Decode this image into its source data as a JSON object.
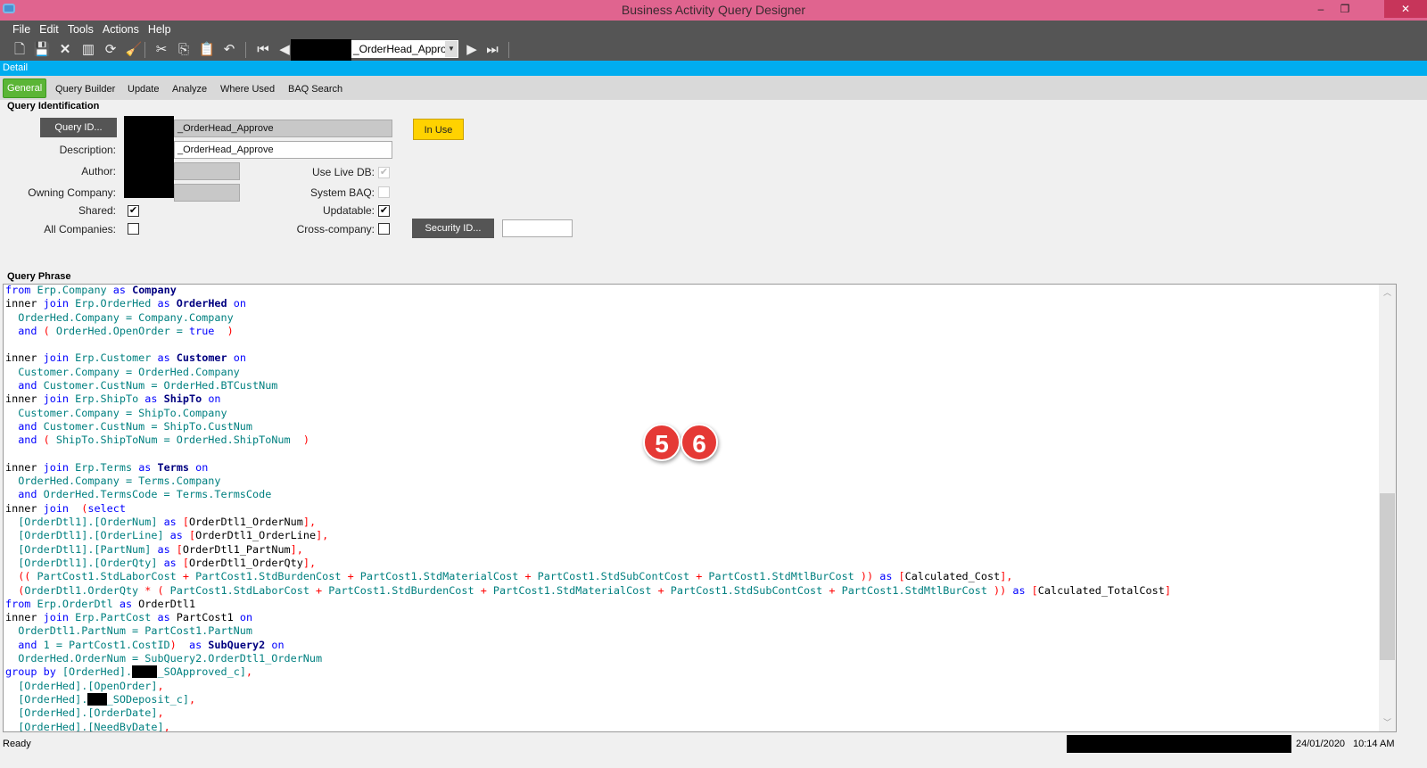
{
  "window": {
    "title": "Business Activity Query Designer",
    "min": "–",
    "restore": "❐",
    "close": "✕"
  },
  "menu": [
    "File",
    "Edit",
    "Tools",
    "Actions",
    "Help"
  ],
  "toolbar": {
    "record_combo": "_OrderHead_Appro"
  },
  "detail_bar": "Detail",
  "tabs": [
    "General",
    "Query Builder",
    "Update",
    "Analyze",
    "Where Used",
    "BAQ Search"
  ],
  "query_identification": {
    "section": "Query Identification",
    "query_id_button": "Query ID...",
    "query_id": "_OrderHead_Approve",
    "in_use_button": "In Use",
    "description_label": "Description:",
    "description": "_OrderHead_Approve",
    "author_label": "Author:",
    "owning_company_label": "Owning Company:",
    "shared_label": "Shared:",
    "shared": true,
    "all_companies_label": "All Companies:",
    "all_companies": false,
    "use_live_db_label": "Use Live DB:",
    "use_live_db": true,
    "system_baq_label": "System BAQ:",
    "system_baq": false,
    "updatable_label": "Updatable:",
    "updatable": true,
    "cross_company_label": "Cross-company:",
    "cross_company": false,
    "security_id_button": "Security ID...",
    "security_id": ""
  },
  "query_phrase": {
    "section": "Query Phrase",
    "lines": [
      [
        [
          "k",
          "from"
        ],
        [
          "i",
          " Erp.Company "
        ],
        [
          "k",
          "as"
        ],
        [
          "a",
          " Company"
        ]
      ],
      [
        [
          "p",
          "inner "
        ],
        [
          "k",
          "join"
        ],
        [
          "i",
          " Erp.OrderHed "
        ],
        [
          "k",
          "as"
        ],
        [
          "a",
          " OrderHed"
        ],
        [
          "k",
          " on"
        ]
      ],
      [
        [
          "i",
          "  OrderHed.Company = Company.Company"
        ]
      ],
      [
        [
          "k",
          "  and"
        ],
        [
          "r",
          " ("
        ],
        [
          "i",
          " OrderHed.OpenOrder = "
        ],
        [
          "k",
          "true"
        ],
        [
          "r",
          "  )"
        ]
      ],
      [],
      [
        [
          "p",
          "inner "
        ],
        [
          "k",
          "join"
        ],
        [
          "i",
          " Erp.Customer "
        ],
        [
          "k",
          "as"
        ],
        [
          "a",
          " Customer"
        ],
        [
          "k",
          " on"
        ]
      ],
      [
        [
          "i",
          "  Customer.Company = OrderHed.Company"
        ]
      ],
      [
        [
          "k",
          "  and"
        ],
        [
          "i",
          " Customer.CustNum = OrderHed.BTCustNum"
        ]
      ],
      [
        [
          "p",
          "inner "
        ],
        [
          "k",
          "join"
        ],
        [
          "i",
          " Erp.ShipTo "
        ],
        [
          "k",
          "as"
        ],
        [
          "a",
          " ShipTo"
        ],
        [
          "k",
          " on"
        ]
      ],
      [
        [
          "i",
          "  Customer.Company = ShipTo.Company"
        ]
      ],
      [
        [
          "k",
          "  and"
        ],
        [
          "i",
          " Customer.CustNum = ShipTo.CustNum"
        ]
      ],
      [
        [
          "k",
          "  and"
        ],
        [
          "r",
          " ("
        ],
        [
          "i",
          " ShipTo.ShipToNum = OrderHed.ShipToNum  "
        ],
        [
          "r",
          ")"
        ]
      ],
      [],
      [
        [
          "p",
          "inner "
        ],
        [
          "k",
          "join"
        ],
        [
          "i",
          " Erp.Terms "
        ],
        [
          "k",
          "as"
        ],
        [
          "a",
          " Terms"
        ],
        [
          "k",
          " on"
        ]
      ],
      [
        [
          "i",
          "  OrderHed.Company = Terms.Company"
        ]
      ],
      [
        [
          "k",
          "  and"
        ],
        [
          "i",
          " OrderHed.TermsCode = Terms.TermsCode"
        ]
      ],
      [
        [
          "p",
          "inner "
        ],
        [
          "k",
          "join"
        ],
        [
          "r",
          "  ("
        ],
        [
          "k",
          "select"
        ]
      ],
      [
        [
          "i",
          "  [OrderDtl1].[OrderNum] "
        ],
        [
          "k",
          "as"
        ],
        [
          "r",
          " ["
        ],
        [
          "p",
          "OrderDtl1_OrderNum"
        ],
        [
          "r",
          "],"
        ]
      ],
      [
        [
          "i",
          "  [OrderDtl1].[OrderLine] "
        ],
        [
          "k",
          "as"
        ],
        [
          "r",
          " ["
        ],
        [
          "p",
          "OrderDtl1_OrderLine"
        ],
        [
          "r",
          "],"
        ]
      ],
      [
        [
          "i",
          "  [OrderDtl1].[PartNum] "
        ],
        [
          "k",
          "as"
        ],
        [
          "r",
          " ["
        ],
        [
          "p",
          "OrderDtl1_PartNum"
        ],
        [
          "r",
          "],"
        ]
      ],
      [
        [
          "i",
          "  [OrderDtl1].[OrderQty] "
        ],
        [
          "k",
          "as"
        ],
        [
          "r",
          " ["
        ],
        [
          "p",
          "OrderDtl1_OrderQty"
        ],
        [
          "r",
          "],"
        ]
      ],
      [
        [
          "r",
          "  (("
        ],
        [
          "i",
          " PartCost1.StdLaborCost "
        ],
        [
          "r",
          "+"
        ],
        [
          "i",
          " PartCost1.StdBurdenCost "
        ],
        [
          "r",
          "+"
        ],
        [
          "i",
          " PartCost1.StdMaterialCost "
        ],
        [
          "r",
          "+"
        ],
        [
          "i",
          " PartCost1.StdSubContCost "
        ],
        [
          "r",
          "+"
        ],
        [
          "i",
          " PartCost1.StdMtlBurCost "
        ],
        [
          "r",
          "))"
        ],
        [
          "k",
          " as"
        ],
        [
          "r",
          " ["
        ],
        [
          "p",
          "Calculated_Cost"
        ],
        [
          "r",
          "],"
        ]
      ],
      [
        [
          "r",
          "  ("
        ],
        [
          "i",
          "OrderDtl1.OrderQty "
        ],
        [
          "r",
          "* ("
        ],
        [
          "i",
          " PartCost1.StdLaborCost "
        ],
        [
          "r",
          "+"
        ],
        [
          "i",
          " PartCost1.StdBurdenCost "
        ],
        [
          "r",
          "+"
        ],
        [
          "i",
          " PartCost1.StdMaterialCost "
        ],
        [
          "r",
          "+"
        ],
        [
          "i",
          " PartCost1.StdSubContCost "
        ],
        [
          "r",
          "+"
        ],
        [
          "i",
          " PartCost1.StdMtlBurCost "
        ],
        [
          "r",
          "))"
        ],
        [
          "k",
          " as"
        ],
        [
          "r",
          " ["
        ],
        [
          "p",
          "Calculated_TotalCost"
        ],
        [
          "r",
          "]"
        ]
      ],
      [
        [
          "k",
          "from"
        ],
        [
          "i",
          " Erp.OrderDtl "
        ],
        [
          "k",
          "as"
        ],
        [
          "p",
          " OrderDtl1"
        ]
      ],
      [
        [
          "p",
          "inner "
        ],
        [
          "k",
          "join"
        ],
        [
          "i",
          " Erp.PartCost "
        ],
        [
          "k",
          "as"
        ],
        [
          "p",
          " PartCost1"
        ],
        [
          "k",
          " on"
        ]
      ],
      [
        [
          "i",
          "  OrderDtl1.PartNum = PartCost1.PartNum"
        ]
      ],
      [
        [
          "k",
          "  and"
        ],
        [
          "i",
          " 1 = PartCost1.CostID"
        ],
        [
          "r",
          ")"
        ],
        [
          "k",
          "  as"
        ],
        [
          "a",
          " SubQuery2"
        ],
        [
          "k",
          " on"
        ]
      ],
      [
        [
          "i",
          "  OrderHed.OrderNum = SubQuery2.OrderDtl1_OrderNum"
        ]
      ],
      [
        [
          "k",
          "group by"
        ],
        [
          "i",
          " [OrderHed]."
        ],
        [
          "x",
          "xxxx"
        ],
        [
          "i",
          "_SOApproved_c]"
        ],
        [
          "r",
          ","
        ]
      ],
      [
        [
          "i",
          "  [OrderHed].[OpenOrder]"
        ],
        [
          "r",
          ","
        ]
      ],
      [
        [
          "i",
          "  [OrderHed]."
        ],
        [
          "x",
          "xxx"
        ],
        [
          "i",
          "_SODeposit_c]"
        ],
        [
          "r",
          ","
        ]
      ],
      [
        [
          "i",
          "  [OrderHed].[OrderDate]"
        ],
        [
          "r",
          ","
        ]
      ],
      [
        [
          "i",
          "  [OrderHed].[NeedByDate]"
        ],
        [
          "r",
          ","
        ]
      ]
    ]
  },
  "annotations": [
    "5",
    "6"
  ],
  "status": {
    "text": "Ready",
    "date": "24/01/2020",
    "time": "10:14 AM"
  }
}
